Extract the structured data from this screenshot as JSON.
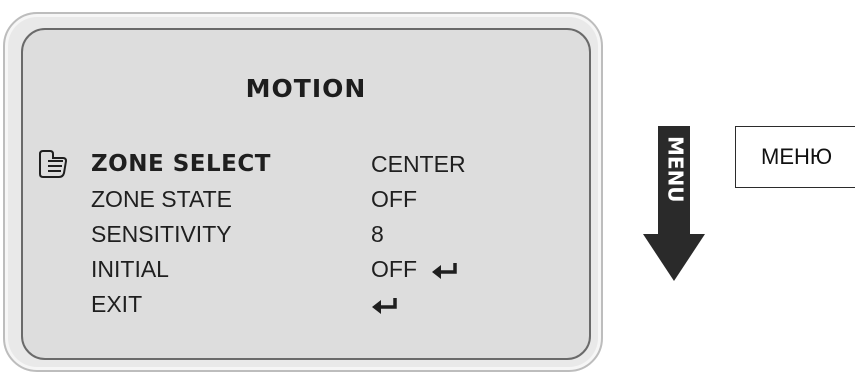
{
  "screen": {
    "title": "MOTION",
    "items": [
      {
        "label": "ZONE SELECT",
        "value": "CENTER",
        "selected": true,
        "has_enter_icon": false
      },
      {
        "label": "ZONE STATE",
        "value": "OFF",
        "selected": false,
        "has_enter_icon": false
      },
      {
        "label": "SENSITIVITY",
        "value": "8",
        "selected": false,
        "has_enter_icon": false
      },
      {
        "label": "INITIAL",
        "value": "OFF",
        "selected": false,
        "has_enter_icon": true
      },
      {
        "label": "EXIT",
        "value": "",
        "selected": false,
        "has_enter_icon": true
      }
    ]
  },
  "side": {
    "arrow_text": "MENU",
    "caption": "МЕНЮ"
  },
  "icons": {
    "pointer": "hand-pointer-icon",
    "enter": "enter-return-icon",
    "arrow": "down-arrow-icon"
  },
  "colors": {
    "screen_bg": "#dddddd",
    "text": "#1f1f1f",
    "arrow": "#2a2a2a"
  }
}
